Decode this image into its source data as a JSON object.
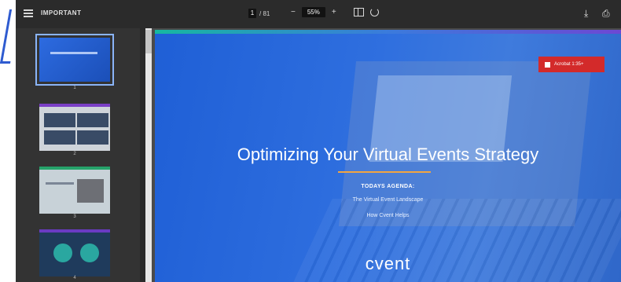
{
  "toolbar": {
    "title": "IMPORTANT",
    "page_current": "1",
    "page_total": "/ 81",
    "zoom_out_label": "−",
    "zoom_value": "55%",
    "zoom_in_label": "+",
    "download_icon": "⤓",
    "print_icon": "⎙"
  },
  "sidebar": {
    "thumbs": [
      {
        "page": "1"
      },
      {
        "page": "2"
      },
      {
        "page": "3"
      },
      {
        "page": "4"
      }
    ]
  },
  "slide": {
    "badge_label": "Acrobat 1:35+",
    "title": "Optimizing Your Virtual Events Strategy",
    "agenda_heading": "TODAYS AGENDA:",
    "agenda_items": [
      "The Virtual Event Landscape",
      "How Cvent Helps"
    ],
    "brand": "cvent"
  },
  "colors": {
    "slide_blue": "#2f6fdf",
    "accent_orange": "#f2a541",
    "badge_red": "#d32a2a"
  }
}
